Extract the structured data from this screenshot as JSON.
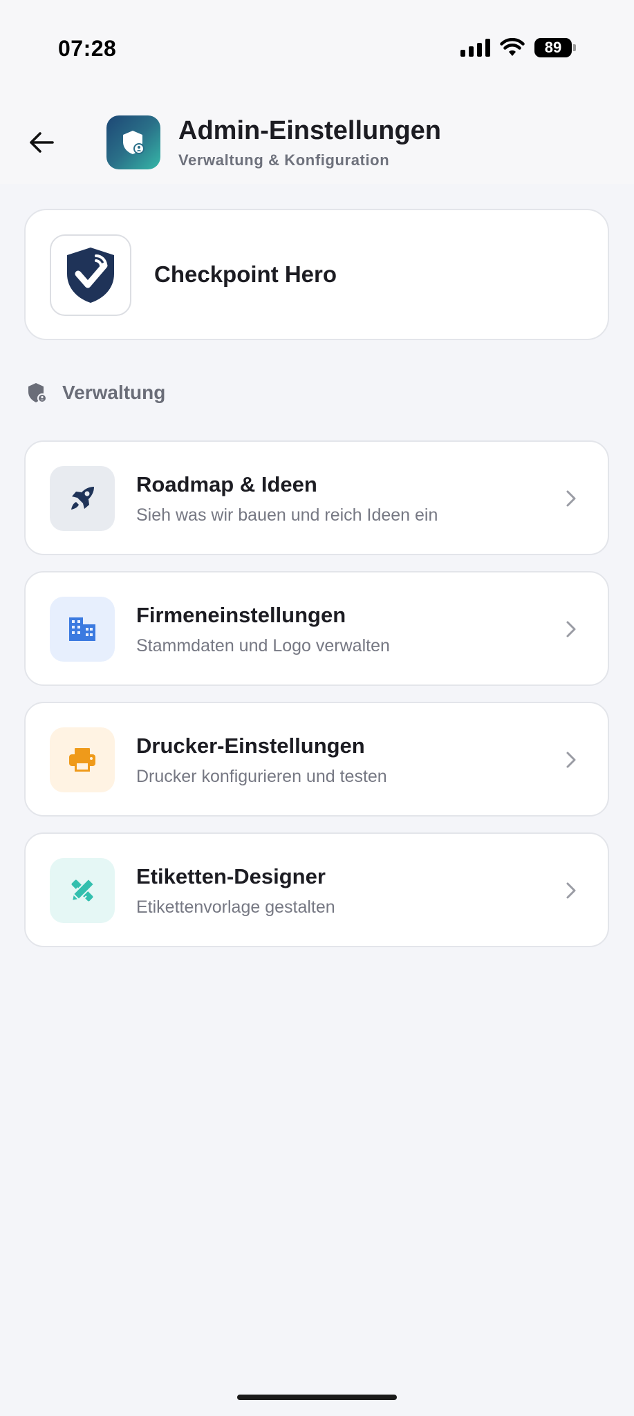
{
  "status_bar": {
    "time": "07:28",
    "battery": "89"
  },
  "header": {
    "title": "Admin-Einstellungen",
    "subtitle": "Verwaltung & Konfiguration",
    "accent_gradient": [
      "#1d4775",
      "#36b8a8"
    ]
  },
  "company": {
    "name": "Checkpoint Hero",
    "logo_icon": "shield-check-icon"
  },
  "section": {
    "label": "Verwaltung",
    "icon": "admin-shield-icon"
  },
  "menu": [
    {
      "title": "Roadmap & Ideen",
      "subtitle": "Sieh was wir bauen und reich Ideen ein",
      "icon": "rocket-icon",
      "icon_bg": "#e8ebf0",
      "icon_color": "#1f3358"
    },
    {
      "title": "Firmeneinstellungen",
      "subtitle": "Stammdaten und Logo verwalten",
      "icon": "building-icon",
      "icon_bg": "#e7effd",
      "icon_color": "#3b7ae0"
    },
    {
      "title": "Drucker-Einstellungen",
      "subtitle": "Drucker konfigurieren und testen",
      "icon": "printer-icon",
      "icon_bg": "#fff3e3",
      "icon_color": "#ef9a1a"
    },
    {
      "title": "Etiketten-Designer",
      "subtitle": "Etikettenvorlage gestalten",
      "icon": "design-tools-icon",
      "icon_bg": "#e5f7f5",
      "icon_color": "#33bfae"
    }
  ]
}
